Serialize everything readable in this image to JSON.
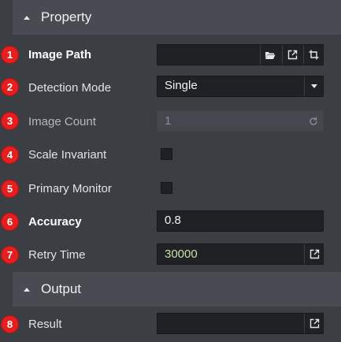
{
  "sections": {
    "property": {
      "title": "Property"
    },
    "output": {
      "title": "Output"
    }
  },
  "rows": [
    {
      "badge": "1",
      "label": "Image Path",
      "value": ""
    },
    {
      "badge": "2",
      "label": "Detection Mode",
      "value": "Single"
    },
    {
      "badge": "3",
      "label": "Image Count",
      "value": "1"
    },
    {
      "badge": "4",
      "label": "Scale Invariant",
      "checked": false
    },
    {
      "badge": "5",
      "label": "Primary Monitor",
      "checked": false
    },
    {
      "badge": "6",
      "label": "Accuracy",
      "value": "0.8"
    },
    {
      "badge": "7",
      "label": "Retry Time",
      "value": "30000"
    },
    {
      "badge": "8",
      "label": "Result",
      "value": ""
    }
  ],
  "colors": {
    "panel_bg": "#3b3f44",
    "header_bg": "#484c52",
    "field_bg": "#1f2125",
    "badge": "#e51f1f",
    "retry_value_text": "#c5e1a5"
  },
  "icons": {
    "image_path_buttons": [
      "folder-open-icon",
      "open-external-icon",
      "crop-icon"
    ],
    "detection_mode_button": "dropdown-arrow-icon",
    "image_count_button": "refresh-icon",
    "retry_time_button": "open-external-icon",
    "result_button": "open-external-icon"
  }
}
